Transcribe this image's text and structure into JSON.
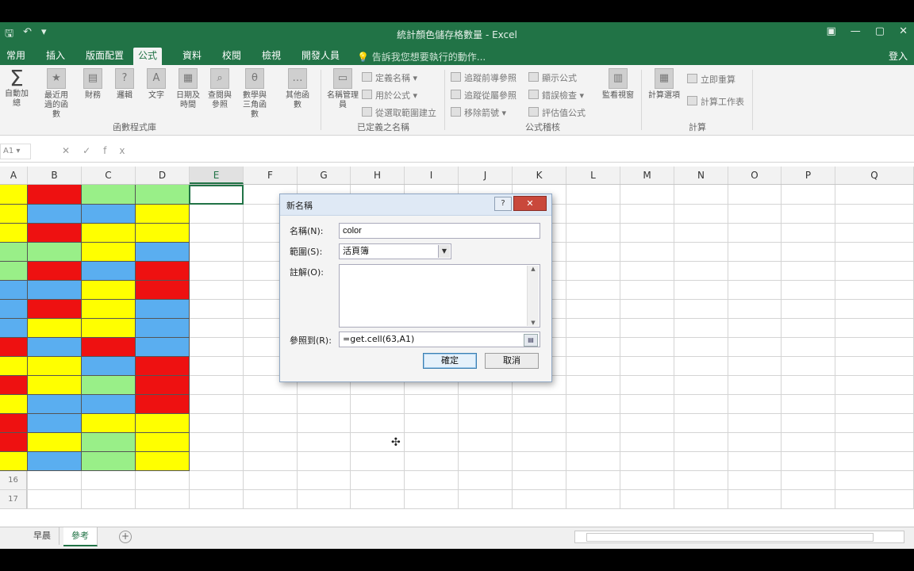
{
  "app": {
    "window_title": "統計顏色儲存格數量 - Excel",
    "sign_in": "登入",
    "tell_me": "告訴我您想要執行的動作..."
  },
  "tabs": [
    "常用",
    "插入",
    "版面配置",
    "公式",
    "資料",
    "校閱",
    "檢視",
    "開發人員"
  ],
  "active_tab": "公式",
  "ribbon": {
    "function_library": {
      "label": "函數程式庫",
      "buttons": [
        "自動加總",
        "最近用過的函數",
        "財務",
        "邏輯",
        "文字",
        "日期及時間",
        "查閱與參照",
        "數學與三角函數",
        "其他函數"
      ]
    },
    "defined_names": {
      "label": "已定義之名稱",
      "name_manager": "名稱管理員",
      "items": [
        "定義名稱",
        "用於公式",
        "從選取範圍建立"
      ]
    },
    "formula_auditing": {
      "label": "公式稽核",
      "items": [
        "追蹤前導參照",
        "追蹤從屬參照",
        "移除箭號",
        "顯示公式",
        "錯誤檢查",
        "評估值公式"
      ],
      "watch_window": "監看視窗"
    },
    "calculation": {
      "label": "計算",
      "calc_options": "計算選項",
      "items": [
        "立即重算",
        "計算工作表"
      ]
    }
  },
  "columns": [
    "A",
    "B",
    "C",
    "D",
    "E",
    "F",
    "G",
    "H",
    "I",
    "J",
    "K",
    "L",
    "M",
    "N",
    "O",
    "P",
    "Q"
  ],
  "selected_column": "E",
  "row_numbers": [
    "",
    "",
    "",
    "",
    "",
    "",
    "",
    "",
    "",
    "",
    "",
    "",
    "",
    "",
    "",
    "16",
    "17"
  ],
  "colors": {
    "red": "#ee1111",
    "yellow": "#ffff00",
    "blue": "#5aaef0",
    "green": "#99ef88",
    "excel_green": "#217346"
  },
  "cell_colors": [
    [
      "yellow",
      "red",
      "green",
      "green"
    ],
    [
      "yellow",
      "blue",
      "blue",
      "yellow"
    ],
    [
      "yellow",
      "red",
      "yellow",
      "yellow"
    ],
    [
      "green",
      "green",
      "yellow",
      "blue"
    ],
    [
      "green",
      "red",
      "blue",
      "red"
    ],
    [
      "blue",
      "blue",
      "yellow",
      "red"
    ],
    [
      "blue",
      "red",
      "yellow",
      "blue"
    ],
    [
      "blue",
      "yellow",
      "yellow",
      "blue"
    ],
    [
      "red",
      "blue",
      "red",
      "blue"
    ],
    [
      "yellow",
      "yellow",
      "blue",
      "red"
    ],
    [
      "red",
      "yellow",
      "green",
      "red"
    ],
    [
      "yellow",
      "blue",
      "blue",
      "red"
    ],
    [
      "red",
      "blue",
      "yellow",
      "yellow"
    ],
    [
      "red",
      "yellow",
      "green",
      "yellow"
    ],
    [
      "yellow",
      "blue",
      "green",
      "yellow"
    ]
  ],
  "sheets": [
    "早晨",
    "參考"
  ],
  "active_sheet": "參考",
  "dialog": {
    "title": "新名稱",
    "help": "?",
    "close": "✕",
    "name_label": "名稱(N):",
    "name_value": "color",
    "scope_label": "範圍(S):",
    "scope_value": "活頁簿",
    "comment_label": "註解(O):",
    "comment_value": "",
    "refers_label": "參照到(R):",
    "refers_value": "=get.cell(63,A1)",
    "ok": "確定",
    "cancel": "取消"
  }
}
